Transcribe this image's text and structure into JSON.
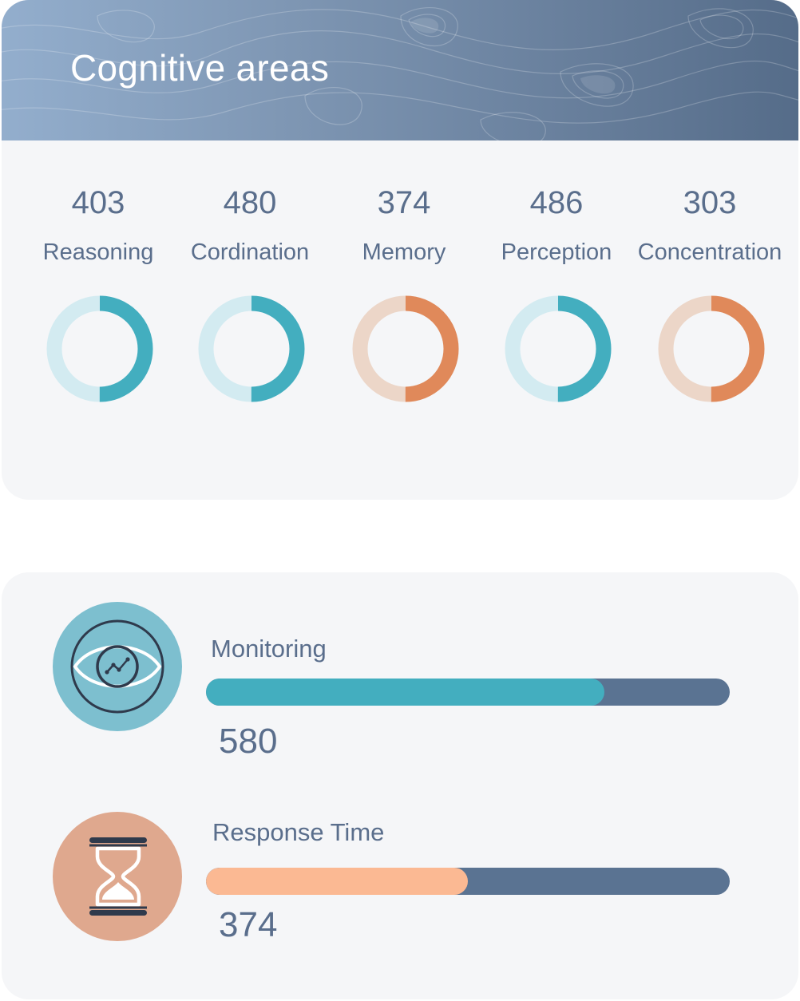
{
  "header": {
    "title": "Cognitive areas"
  },
  "colors": {
    "teal": "#43aebf",
    "teal_light": "#d3ebf1",
    "orange": "#e0895a",
    "orange_light": "#ecd6c8",
    "text": "#5a6e8c",
    "bar_track": "#5a7392",
    "peach": "#fbb993",
    "icon_teal_bg": "#7dbfcf",
    "icon_orange_bg": "#dfa88e"
  },
  "cognitive_areas": [
    {
      "value": "403",
      "label": "Reasoning",
      "color": "teal",
      "fill_fraction": 0.5
    },
    {
      "value": "480",
      "label": "Cordination",
      "color": "teal",
      "fill_fraction": 0.5
    },
    {
      "value": "374",
      "label": "Memory",
      "color": "orange",
      "fill_fraction": 0.5
    },
    {
      "value": "486",
      "label": "Perception",
      "color": "teal",
      "fill_fraction": 0.5
    },
    {
      "value": "303",
      "label": "Concentration",
      "color": "orange",
      "fill_fraction": 0.5
    }
  ],
  "stats": [
    {
      "label": "Monitoring",
      "value": "580",
      "progress": 0.76,
      "icon": "eye-chart-icon"
    },
    {
      "label": "Response Time",
      "value": "374",
      "progress": 0.5,
      "icon": "hourglass-icon"
    }
  ]
}
